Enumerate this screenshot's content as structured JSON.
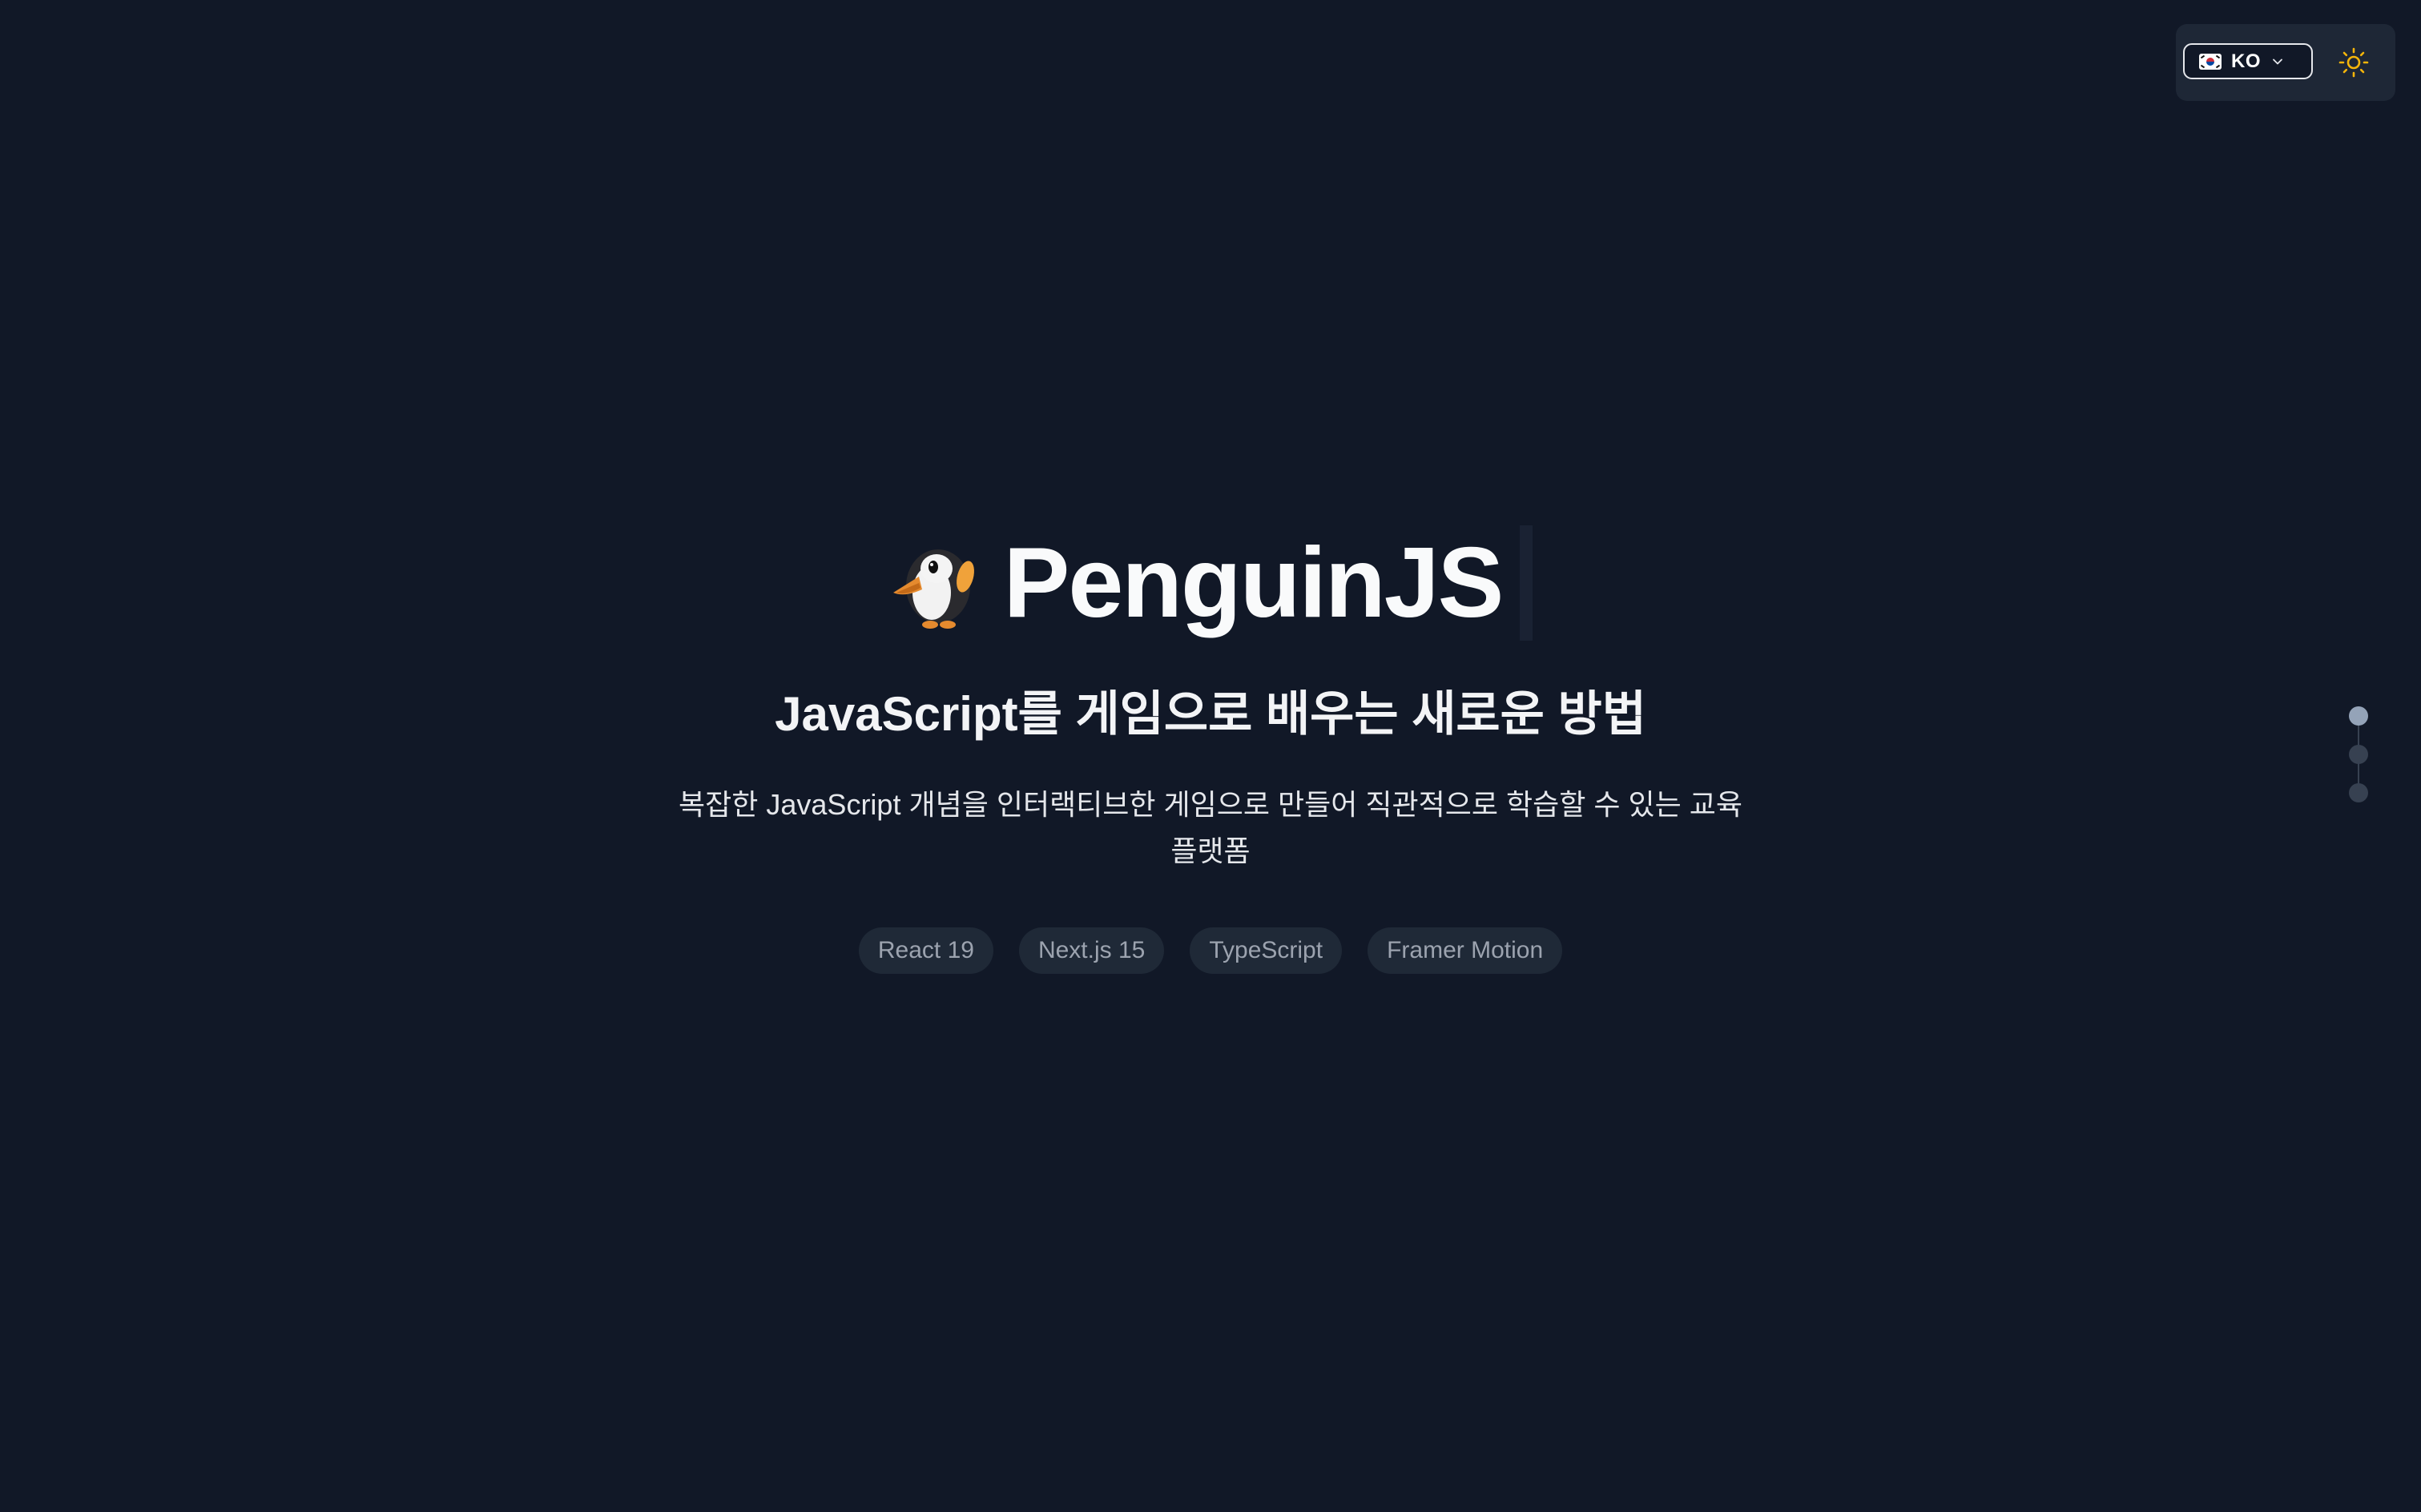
{
  "header": {
    "language": {
      "code": "KO",
      "flag_icon": "south-korea-flag-icon",
      "chevron_icon": "chevron-down-icon"
    },
    "theme_toggle": {
      "icon": "sun-icon",
      "color": "#f5b50a"
    }
  },
  "hero": {
    "emoji_icon": "penguin-icon",
    "brand": "PenguinJS",
    "tagline": "JavaScript를 게임으로 배우는 새로운 방법",
    "description": "복잡한 JavaScript 개념을 인터랙티브한 게임으로 만들어 직관적으로 학습할 수 있는 교육 플랫폼",
    "tags": [
      {
        "label": "React 19"
      },
      {
        "label": "Next.js 15"
      },
      {
        "label": "TypeScript"
      },
      {
        "label": "Framer Motion"
      }
    ]
  },
  "section_nav": {
    "active_index": 0,
    "count": 3,
    "active_color": "#94a3b8",
    "inactive_color": "#374151"
  },
  "colors": {
    "background": "#111827",
    "panel": "#1e2736",
    "tag_background": "#1f2937",
    "tag_text": "#9ca3af"
  }
}
